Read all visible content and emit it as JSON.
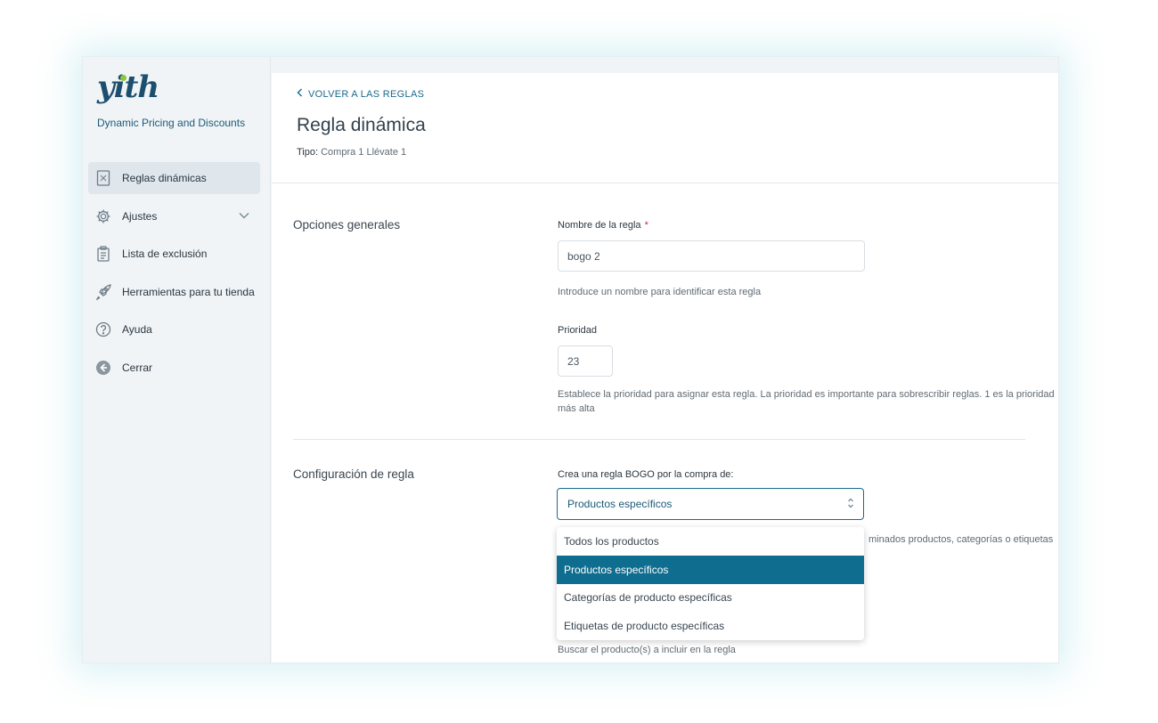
{
  "brand": {
    "logo_text": "yith",
    "plugin_name": "Dynamic Pricing and Discounts"
  },
  "sidebar": {
    "items": [
      {
        "label": "Reglas dinámicas",
        "icon": "receipt-icon",
        "active": true
      },
      {
        "label": "Ajustes",
        "icon": "gear-icon"
      },
      {
        "label": "Lista de exclusión",
        "icon": "clipboard-list-icon"
      },
      {
        "label": "Herramientas para tu tienda",
        "icon": "rocket-icon"
      },
      {
        "label": "Ayuda",
        "icon": "help-circle-icon"
      },
      {
        "label": "Cerrar",
        "icon": "arrow-left-circle-icon"
      }
    ]
  },
  "header": {
    "back_label": "VOLVER A LAS REGLAS",
    "title": "Regla dinámica",
    "type_label": "Tipo:",
    "type_value": "Compra 1 Llévate 1"
  },
  "general": {
    "section_title": "Opciones generales",
    "name_label": "Nombre de la regla",
    "required_mark": "*",
    "name_value": "bogo 2",
    "name_hint": "Introduce un nombre para identificar esta regla",
    "priority_label": "Prioridad",
    "priority_value": "23",
    "priority_hint_line1": "Establece la prioridad para asignar esta regla. La prioridad es importante para sobrescribir reglas. 1 es la prioridad",
    "priority_hint_line2": "más alta"
  },
  "config": {
    "section_title": "Configuración de regla",
    "bogo_label": "Crea una regla BOGO por la compra de:",
    "selected_value": "Productos específicos",
    "partial_hint": "minados productos, categorías o etiquetas",
    "options": [
      "Todos los productos",
      "Productos específicos",
      "Categorías de producto específicas",
      "Etiquetas de producto específicas"
    ],
    "search_hint": "Buscar el producto(s) a incluir en la regla"
  },
  "colors": {
    "accent": "#0f6e8f",
    "brand": "#1c4f6e",
    "brand_dot": "#8dc63f",
    "required": "#d0263b"
  }
}
